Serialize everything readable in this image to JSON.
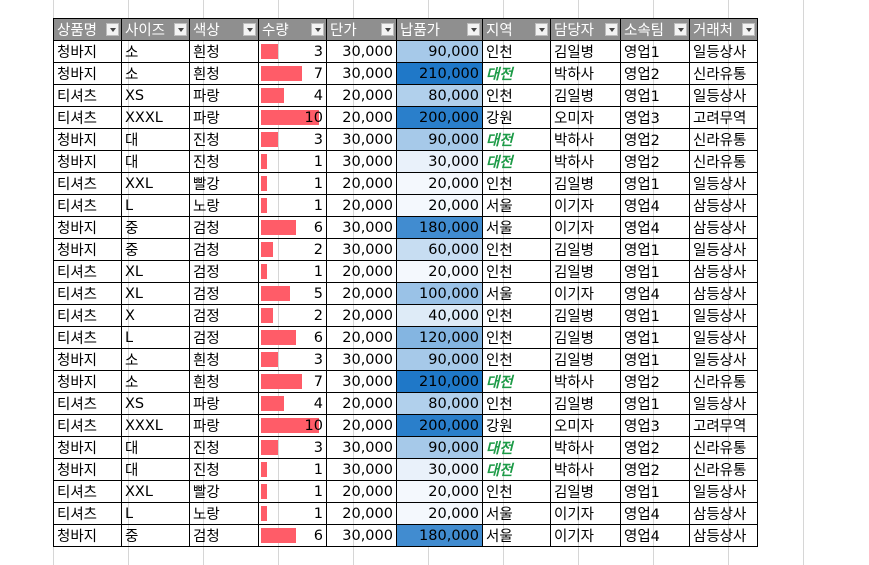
{
  "headers": [
    "상품명",
    "사이즈",
    "색상",
    "수량",
    "단가",
    "납품가",
    "지역",
    "담당자",
    "소속팀",
    "거래처"
  ],
  "rows": [
    [
      "청바지",
      "소",
      "흰청",
      3,
      "30,000",
      "90,000",
      "인천",
      "김일병",
      "영업1",
      "일등상사"
    ],
    [
      "청바지",
      "소",
      "흰청",
      7,
      "30,000",
      "210,000",
      "대전",
      "박하사",
      "영업2",
      "신라유통"
    ],
    [
      "티셔츠",
      "XS",
      "파랑",
      4,
      "20,000",
      "80,000",
      "인천",
      "김일병",
      "영업1",
      "일등상사"
    ],
    [
      "티셔츠",
      "XXXL",
      "파랑",
      10,
      "20,000",
      "200,000",
      "강원",
      "오미자",
      "영업3",
      "고려무역"
    ],
    [
      "청바지",
      "대",
      "진청",
      3,
      "30,000",
      "90,000",
      "대전",
      "박하사",
      "영업2",
      "신라유통"
    ],
    [
      "청바지",
      "대",
      "진청",
      1,
      "30,000",
      "30,000",
      "대전",
      "박하사",
      "영업2",
      "신라유통"
    ],
    [
      "티셔츠",
      "XXL",
      "빨강",
      1,
      "20,000",
      "20,000",
      "인천",
      "김일병",
      "영업1",
      "일등상사"
    ],
    [
      "티셔츠",
      "L",
      "노랑",
      1,
      "20,000",
      "20,000",
      "서울",
      "이기자",
      "영업4",
      "삼등상사"
    ],
    [
      "청바지",
      "중",
      "검청",
      6,
      "30,000",
      "180,000",
      "서울",
      "이기자",
      "영업4",
      "삼등상사"
    ],
    [
      "청바지",
      "중",
      "검청",
      2,
      "30,000",
      "60,000",
      "인천",
      "김일병",
      "영업1",
      "일등상사"
    ],
    [
      "티셔츠",
      "XL",
      "검정",
      1,
      "20,000",
      "20,000",
      "인천",
      "김일병",
      "영업1",
      "삼등상사"
    ],
    [
      "티셔츠",
      "XL",
      "검정",
      5,
      "20,000",
      "100,000",
      "서울",
      "이기자",
      "영업4",
      "삼등상사"
    ],
    [
      "티셔츠",
      "X",
      "검정",
      2,
      "20,000",
      "40,000",
      "인천",
      "김일병",
      "영업1",
      "일등상사"
    ],
    [
      "티셔츠",
      "L",
      "검정",
      6,
      "20,000",
      "120,000",
      "인천",
      "김일병",
      "영업1",
      "일등상사"
    ],
    [
      "청바지",
      "소",
      "흰청",
      3,
      "30,000",
      "90,000",
      "인천",
      "김일병",
      "영업1",
      "일등상사"
    ],
    [
      "청바지",
      "소",
      "흰청",
      7,
      "30,000",
      "210,000",
      "대전",
      "박하사",
      "영업2",
      "신라유통"
    ],
    [
      "티셔츠",
      "XS",
      "파랑",
      4,
      "20,000",
      "80,000",
      "인천",
      "김일병",
      "영업1",
      "일등상사"
    ],
    [
      "티셔츠",
      "XXXL",
      "파랑",
      10,
      "20,000",
      "200,000",
      "강원",
      "오미자",
      "영업3",
      "고려무역"
    ],
    [
      "청바지",
      "대",
      "진청",
      3,
      "30,000",
      "90,000",
      "대전",
      "박하사",
      "영업2",
      "신라유통"
    ],
    [
      "청바지",
      "대",
      "진청",
      1,
      "30,000",
      "30,000",
      "대전",
      "박하사",
      "영업2",
      "신라유통"
    ],
    [
      "티셔츠",
      "XXL",
      "빨강",
      1,
      "20,000",
      "20,000",
      "인천",
      "김일병",
      "영업1",
      "일등상사"
    ],
    [
      "티셔츠",
      "L",
      "노랑",
      1,
      "20,000",
      "20,000",
      "서울",
      "이기자",
      "영업4",
      "삼등상사"
    ],
    [
      "청바지",
      "중",
      "검청",
      6,
      "30,000",
      "180,000",
      "서울",
      "이기자",
      "영업4",
      "삼등상사"
    ]
  ],
  "formatting": {
    "qty_max": 10,
    "databar_color": "#ff5c68",
    "colorscale_low": "#f4f8fd",
    "colorscale_high": "#1f78c8",
    "highlight_region": "대전",
    "highlight_color": "#1d9b47",
    "header_bg": "#8f8f8f"
  }
}
